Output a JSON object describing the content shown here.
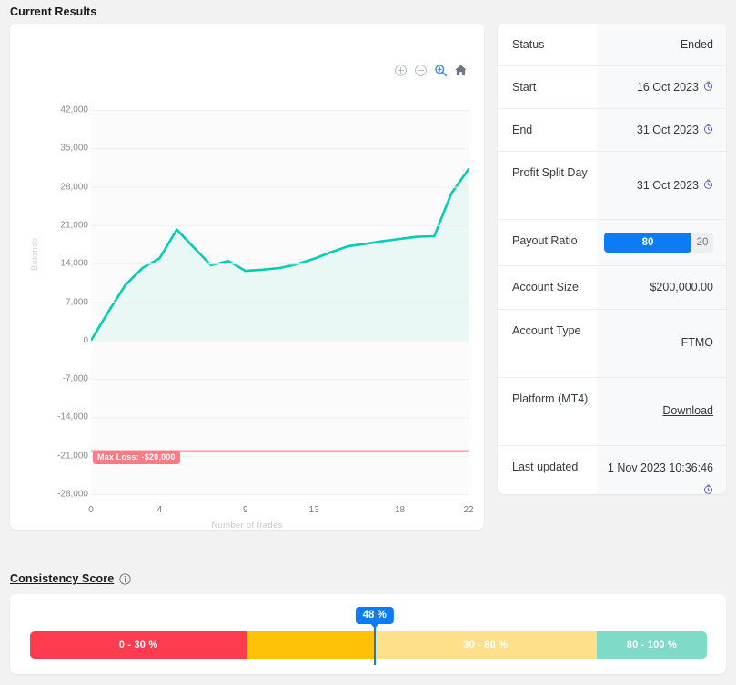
{
  "sections": {
    "current_results_title": "Current Results",
    "consistency_title": "Consistency Score"
  },
  "chart_toolbar": {
    "zoom_in": "zoom-in-icon",
    "zoom_out": "zoom-out-icon",
    "selection_zoom": "selection-zoom-icon",
    "reset": "home-icon"
  },
  "chart_data": {
    "type": "area",
    "title": "",
    "xlabel": "Number of trades",
    "ylabel": "Balance",
    "xlim": [
      0,
      22
    ],
    "ylim": [
      -28000,
      42000
    ],
    "xticks": [
      0,
      4,
      9,
      13,
      18,
      22
    ],
    "xtick_labels": [
      "0",
      "4",
      "9",
      "13",
      "18",
      "22"
    ],
    "yticks": [
      42000,
      35000,
      28000,
      21000,
      14000,
      7000,
      0,
      -7000,
      -14000,
      -21000,
      -28000
    ],
    "ytick_labels": [
      "42,000",
      "35,000",
      "28,000",
      "21,000",
      "14,000",
      "7,000",
      "0",
      "-7,000",
      "-14,000",
      "-21,000",
      "-28,000"
    ],
    "grid": true,
    "legend": false,
    "line_color": "#00cdb4",
    "fill_color": "#eaf8f5",
    "series": [
      {
        "name": "Balance",
        "x": [
          0,
          1,
          2,
          3,
          4,
          5,
          6,
          7,
          8,
          9,
          10,
          11,
          12,
          13,
          14,
          15,
          16,
          17,
          18,
          19,
          20,
          21,
          22
        ],
        "values": [
          0,
          5200,
          10100,
          13200,
          15000,
          20200,
          16900,
          13700,
          14500,
          12700,
          12900,
          13200,
          13900,
          14900,
          16100,
          17200,
          17600,
          18100,
          18500,
          18900,
          19000,
          26800,
          31200
        ]
      }
    ],
    "threshold_line": {
      "label": "Max Loss: -$20,000",
      "value": -20000,
      "color": "#fd7a85"
    }
  },
  "info_table": {
    "rows": [
      {
        "label": "Status",
        "value": "Ended",
        "icon": null,
        "type": "text"
      },
      {
        "label": "Start",
        "value": "16 Oct 2023",
        "icon": "clock-icon",
        "type": "text"
      },
      {
        "label": "End",
        "value": "31 Oct 2023",
        "icon": "clock-icon",
        "type": "text"
      },
      {
        "label": "Profit Split Day",
        "value": "31 Oct 2023",
        "icon": "clock-icon",
        "type": "text"
      },
      {
        "label": "Payout Ratio",
        "value": "80",
        "secondary": "20",
        "type": "ratio"
      },
      {
        "label": "Account Size",
        "value": "$200,000.00",
        "icon": null,
        "type": "text"
      },
      {
        "label": "Account Type",
        "value": "FTMO",
        "icon": null,
        "type": "text"
      },
      {
        "label": "Platform (MT4)",
        "value": "Download",
        "icon": null,
        "type": "link"
      },
      {
        "label": "Last updated",
        "value": "1 Nov 2023 10:36:46",
        "icon": "clock-icon",
        "type": "text"
      }
    ]
  },
  "consistency": {
    "score_label": "48 %",
    "score_value": 48,
    "info_icon": "info-icon",
    "segments": [
      {
        "label": "0 - 30 %",
        "color": "#fd3d4f",
        "width_pct": 32.0
      },
      {
        "label": "",
        "color": "#ffc107",
        "width_pct": 18.9
      },
      {
        "label": "30 - 80 %",
        "color": "#ffe08a",
        "width_pct": 32.8
      },
      {
        "label": "80 - 100 %",
        "color": "#7fdbc8",
        "width_pct": 16.3
      }
    ]
  },
  "colors": {
    "page_bg": "#f2f2f2",
    "card_bg": "#ffffff",
    "accent_blue": "#0d7cf4",
    "teal": "#00cdb4",
    "danger": "#fd7a85"
  }
}
